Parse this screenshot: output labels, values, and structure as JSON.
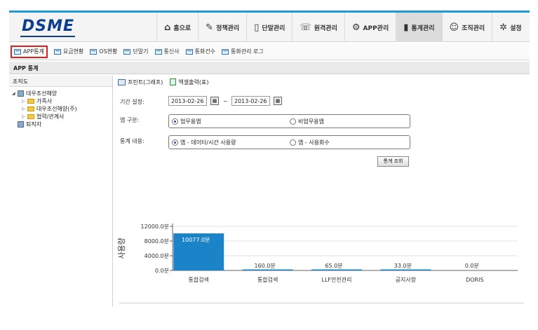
{
  "header": {
    "logo": "DSME",
    "nav": [
      {
        "label": "홈으로",
        "icon": "home-icon",
        "glyph": "⌂"
      },
      {
        "label": "정책관리",
        "icon": "policy-icon",
        "glyph": "✎"
      },
      {
        "label": "단말관리",
        "icon": "device-icon",
        "glyph": "▯"
      },
      {
        "label": "원격관리",
        "icon": "remote-icon",
        "glyph": "☏"
      },
      {
        "label": "APP관리",
        "icon": "app-icon",
        "glyph": "⚙"
      },
      {
        "label": "통계관리",
        "icon": "stats-icon",
        "glyph": "▮"
      },
      {
        "label": "조직관리",
        "icon": "org-icon",
        "glyph": "☺"
      },
      {
        "label": "설정",
        "icon": "settings-icon",
        "glyph": "✲"
      }
    ],
    "active_nav": "통계관리"
  },
  "subtabs": [
    "APP통계",
    "요금현황",
    "OS현황",
    "단말기",
    "통신사",
    "통화건수",
    "통화관리 로그"
  ],
  "active_subtab": "APP통계",
  "page_title": "APP 통계",
  "org_tree": {
    "title": "조직도",
    "nodes": [
      {
        "label": "대우조선해양",
        "level": 0,
        "toggle": "◢",
        "type": "building"
      },
      {
        "label": "가족사",
        "level": 1,
        "toggle": "▷",
        "type": "folder"
      },
      {
        "label": "대우조선해양(주)",
        "level": 1,
        "toggle": "▷",
        "type": "folder"
      },
      {
        "label": "협력/관계사",
        "level": 1,
        "toggle": "▷",
        "type": "folder"
      },
      {
        "label": "퇴직자",
        "level": 0,
        "toggle": "",
        "type": "building"
      }
    ]
  },
  "toolbar": {
    "print_label": "프린트(그래프)",
    "excel_label": "엑셀출력(표)"
  },
  "form": {
    "period_label": "기간 설정:",
    "date_from": "2013-02-26",
    "date_sep": "~",
    "date_to": "2013-02-26",
    "app_type_label": "앱 구분:",
    "app_type_options": [
      "업무용앱",
      "비업무용앱"
    ],
    "app_type_selected": 0,
    "stat_label": "통계 내용:",
    "stat_options": [
      "앱 - 데이터/시간 사용량",
      "앱 - 사용회수"
    ],
    "stat_selected": 0,
    "search_button": "통계 조회"
  },
  "chart_data": {
    "type": "bar",
    "ylabel": "사용량",
    "yticks": [
      "12000.0분",
      "8000.0분",
      "4000.0분",
      "0.0분"
    ],
    "ytick_values": [
      12000,
      8000,
      4000,
      0
    ],
    "ylim": [
      0,
      12000
    ],
    "categories": [
      "통합검색",
      "통합검색",
      "LLF안전관리",
      "공지사항",
      "DORIS"
    ],
    "values": [
      10077.0,
      160.0,
      65.0,
      33.0,
      0.0
    ],
    "value_labels": [
      "10077.0분",
      "160.0분",
      "65.0분",
      "33.0분",
      "0.0분"
    ],
    "bar_color": "#1b84c8",
    "grid": true
  }
}
